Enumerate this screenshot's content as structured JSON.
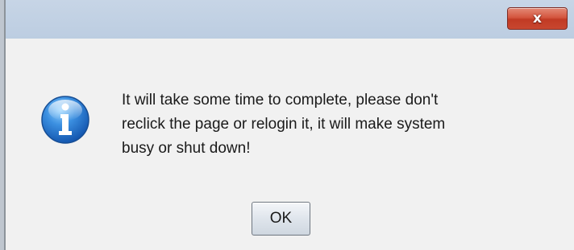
{
  "dialog": {
    "close_symbol": "x",
    "icon": "info-icon",
    "message_lines": [
      "It will take some time to complete, please don't",
      "reclick the page or relogin it, it will make system",
      "busy or shut down!"
    ],
    "ok_label": "OK"
  },
  "colors": {
    "titlebar": "#bccde1",
    "close_button": "#c8472f",
    "dialog_background": "#f1f1f1",
    "info_icon_blue": "#2a7fd4"
  }
}
